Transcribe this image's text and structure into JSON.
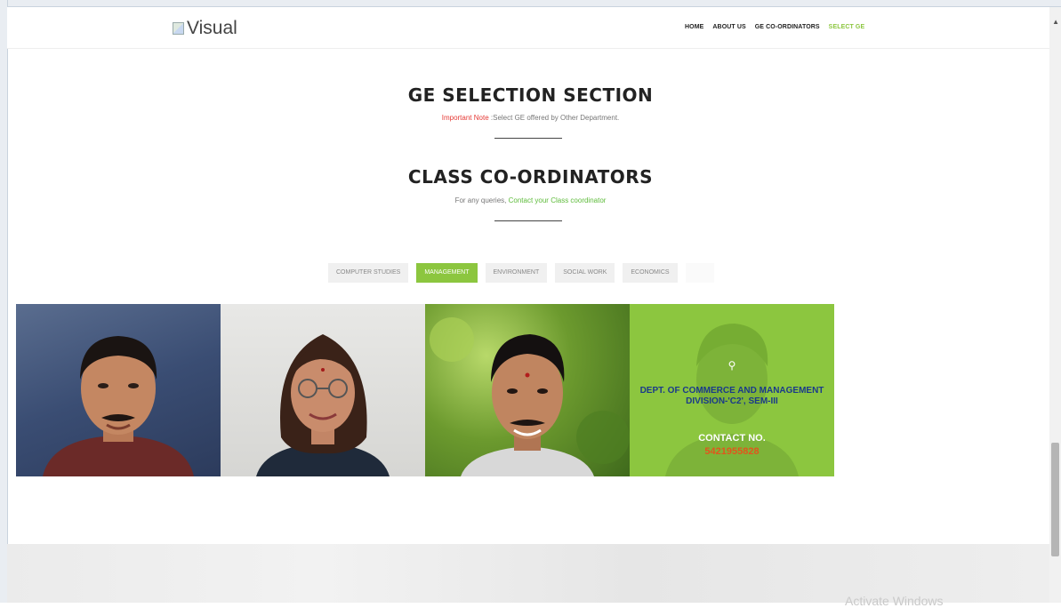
{
  "header": {
    "logo_alt": "Visual",
    "nav": [
      {
        "label": "HOME",
        "active": false
      },
      {
        "label": "ABOUT US",
        "active": false
      },
      {
        "label": "GE CO-ORDINATORS",
        "active": false
      },
      {
        "label": "SELECT GE",
        "active": true
      }
    ]
  },
  "ge_section": {
    "title": "GE SELECTION SECTION",
    "note_label": "Important Note",
    "note_text": ":Select GE offered by Other Department."
  },
  "coordinators_section": {
    "title": "CLASS CO-ORDINATORS",
    "sub_text": "For any queries,",
    "sub_link": "Contact your Class coordinator"
  },
  "tabs": [
    {
      "label": "COMPUTER STUDIES",
      "active": false
    },
    {
      "label": "MANAGEMENT",
      "active": true
    },
    {
      "label": "ENVIRONMENT",
      "active": false
    },
    {
      "label": "SOCIAL WORK",
      "active": false
    },
    {
      "label": "ECONOMICS",
      "active": false
    }
  ],
  "coordinator_card_overlay": {
    "dept_line1": "DEPT. OF COMMERCE AND MANAGEMENT",
    "dept_line2": "DIVISION-'C2', SEM-III",
    "contact_label": "CONTACT NO.",
    "phone": "5421955828",
    "icon": "search-icon"
  },
  "os_watermark": "Activate Windows",
  "colors": {
    "accent": "#8cc63f",
    "note_red": "#e53935",
    "dept_blue": "#1a3a8a",
    "phone_orange": "#e0561d"
  }
}
